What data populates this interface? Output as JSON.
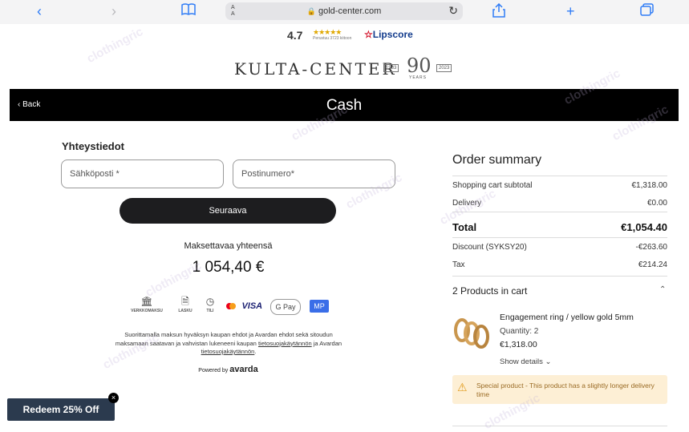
{
  "browser": {
    "text_size": "A A",
    "url": "gold-center.com",
    "icons": [
      "back-icon",
      "forward-icon",
      "bookmarks-icon",
      "lock-icon",
      "reload-icon",
      "share-icon",
      "new-tab-icon",
      "tabs-icon"
    ]
  },
  "rating": {
    "score": "4.7",
    "stars": "★★★★★",
    "reviews": "Perustuu 3723 kiitoon",
    "provider": "Lipscore"
  },
  "logo": {
    "name": "KULTA-CENTER",
    "year_start": "1933",
    "anniversary": "90",
    "years_label": "YEARS",
    "year_end": "2023"
  },
  "header": {
    "back_label": "Back",
    "title": "Cash"
  },
  "contact": {
    "title": "Yhteystiedot",
    "email_placeholder": "Sähköposti *",
    "postcode_placeholder": "Postinumero*",
    "next_button": "Seuraava"
  },
  "payment": {
    "total_label": "Maksettavaa yhteensä",
    "total_amount": "1 054,40 €",
    "methods": [
      {
        "label": "VERKKOMAKSU",
        "icon": "bank-icon"
      },
      {
        "label": "LASKU",
        "icon": "invoice-icon"
      },
      {
        "label": "TILI",
        "icon": "account-icon"
      }
    ],
    "card_label": "VISA",
    "gpay_label": "G Pay",
    "mobilepay_label": "MP",
    "terms_text": "Suorittamalla maksun hyväksyn kaupan ehdot ja Avardan ehdot sekä sitoudun maksamaan saatavan ja vahvistan lukeneeni kaupan",
    "terms_link1": "tietosuojakäytännön",
    "terms_mid": "ja Avardan",
    "terms_link2": "tietosuojakäytännön",
    "powered_by": "Powered by",
    "powered_brand": "avarda"
  },
  "summary": {
    "title": "Order summary",
    "rows": [
      {
        "label": "Shopping cart subtotal",
        "value": "€1,318.00"
      },
      {
        "label": "Delivery",
        "value": "€0.00"
      }
    ],
    "total_label": "Total",
    "total_value": "€1,054.40",
    "discount_label": "Discount (SYKSY20)",
    "discount_value": "-€263.60",
    "tax_label": "Tax",
    "tax_value": "€214.24",
    "products_in_cart": "2 Products in cart",
    "product": {
      "name": "Engagement ring / yellow gold 5mm",
      "quantity": "Quantity: 2",
      "price": "€1,318.00",
      "show_details": "Show details"
    },
    "notice": "Special product - This product has a slightly longer delivery time"
  },
  "promo": {
    "redeem": "Redeem 25% Off",
    "close": "×"
  },
  "watermark": "clothingric"
}
